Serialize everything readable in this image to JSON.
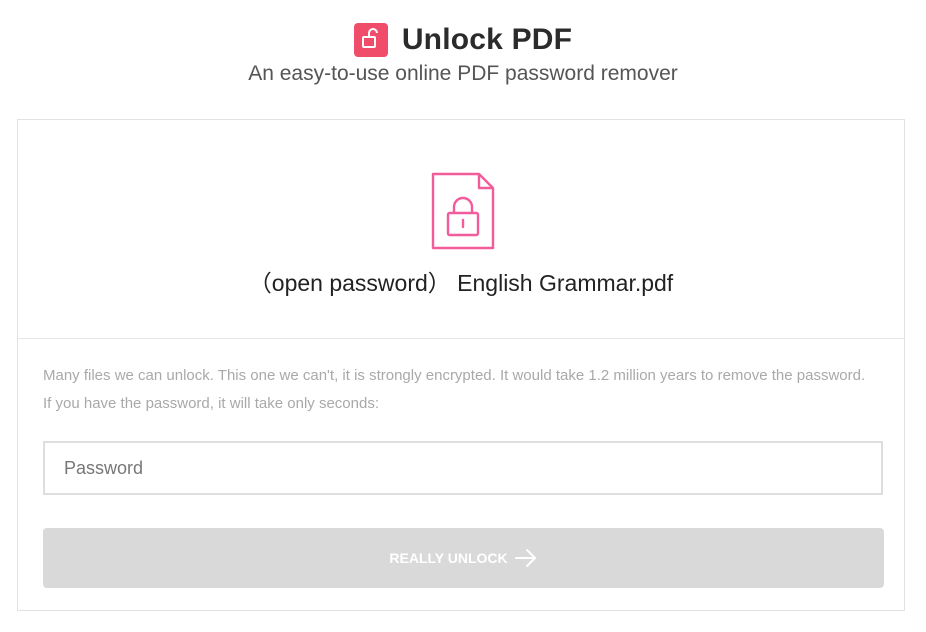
{
  "header": {
    "title": "Unlock PDF",
    "subtitle": "An easy-to-use online PDF password remover"
  },
  "file": {
    "name": "（open password） English Grammar.pdf",
    "icon": "locked-file-icon"
  },
  "message": {
    "line1": "Many files we can unlock. This one we can't, it is strongly encrypted. It would take 1.2 million years to remove the password.",
    "line2": "If you have the password, it will take only seconds:"
  },
  "password": {
    "value": "",
    "placeholder": "Password"
  },
  "unlock_button": {
    "label": "REALLY UNLOCK",
    "icon": "arrow-right-icon"
  },
  "colors": {
    "brand": "#f04d6a",
    "file_icon": "#f25c9b",
    "button_disabled": "#d9d9d9",
    "muted_text": "#a9a9a9"
  }
}
